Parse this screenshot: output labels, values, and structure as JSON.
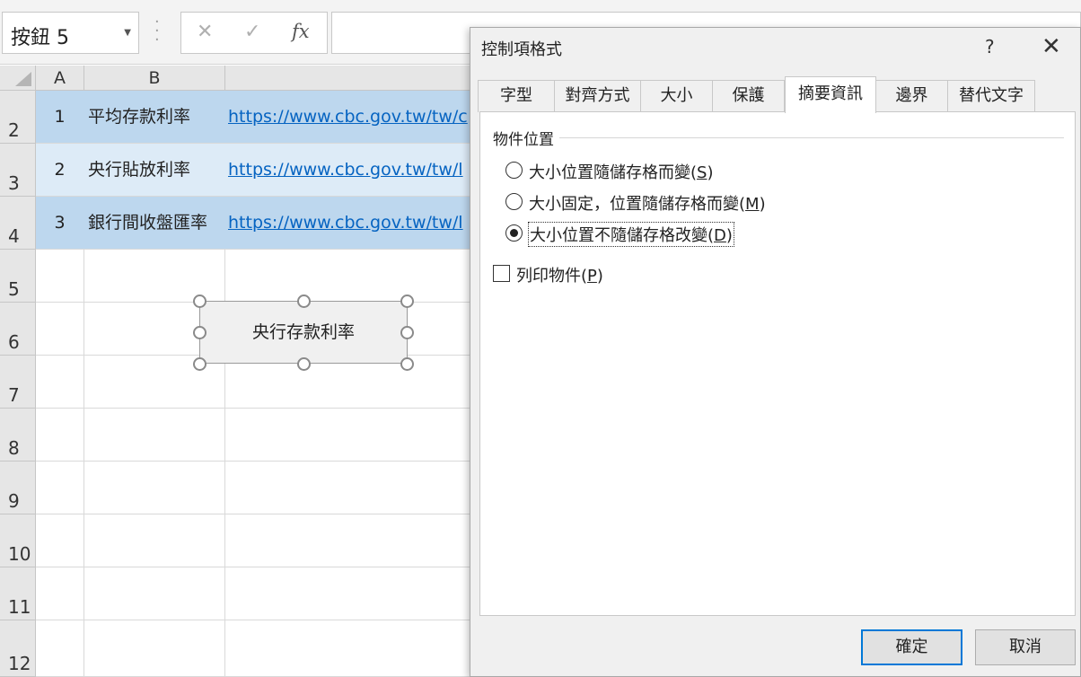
{
  "formula_bar": {
    "name_box": "按鈕 5",
    "cancel_glyph": "✕",
    "enter_glyph": "✓",
    "fx_label": "fx",
    "formula_value": ""
  },
  "sheet": {
    "columns": [
      "A",
      "B"
    ],
    "rows": [
      {
        "num": "2",
        "a": "1",
        "b": "平均存款利率",
        "c": "https://www.cbc.gov.tw/tw/c"
      },
      {
        "num": "3",
        "a": "2",
        "b": "央行貼放利率",
        "c": "https://www.cbc.gov.tw/tw/l"
      },
      {
        "num": "4",
        "a": "3",
        "b": "銀行間收盤匯率",
        "c": "https://www.cbc.gov.tw/tw/l"
      },
      {
        "num": "5"
      },
      {
        "num": "6"
      },
      {
        "num": "7"
      },
      {
        "num": "8"
      },
      {
        "num": "9"
      },
      {
        "num": "10"
      },
      {
        "num": "11"
      },
      {
        "num": "12"
      }
    ],
    "band_colors": [
      "#bdd7ee",
      "#ddebf7"
    ],
    "link_color": "#0563c1"
  },
  "form_button": {
    "label": "央行存款利率"
  },
  "dialog": {
    "title": "控制項格式",
    "help": "?",
    "close": "✕",
    "tabs": [
      "字型",
      "對齊方式",
      "大小",
      "保護",
      "摘要資訊",
      "邊界",
      "替代文字"
    ],
    "active_tab": "摘要資訊",
    "group_label": "物件位置",
    "radios": [
      {
        "label": "大小位置隨儲存格而變",
        "key": "S",
        "checked": false
      },
      {
        "label": "大小固定，位置隨儲存格而變",
        "key": "M",
        "checked": false
      },
      {
        "label": "大小位置不隨儲存格改變",
        "key": "D",
        "checked": true
      }
    ],
    "print_object": {
      "label": "列印物件",
      "key": "P",
      "checked": false
    },
    "ok_label": "確定",
    "cancel_label": "取消",
    "ok_border_color": "#0078d7"
  }
}
